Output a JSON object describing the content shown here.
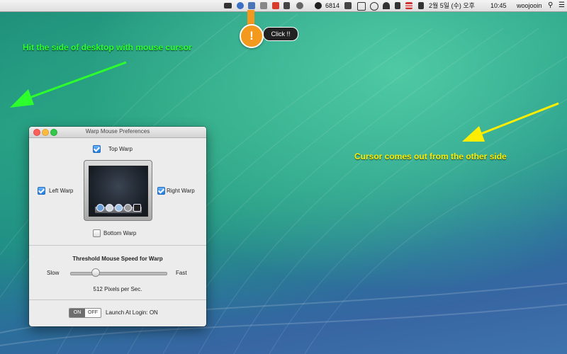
{
  "menubar": {
    "count": "6814",
    "date": "2월 5일 (수) 오후",
    "time": "10:45",
    "user": "woojooin"
  },
  "callout": {
    "exclaim": "!",
    "bubble": "Click !!"
  },
  "annotations": {
    "green": "Hit the side of desktop with mouse cursor",
    "yellow": "Cursor comes out from the other side"
  },
  "window": {
    "title": "Warp Mouse Preferences",
    "top_warp": "Top Warp",
    "left_warp": "Left Warp",
    "right_warp": "Right Warp",
    "bottom_warp": "Bottom Warp",
    "threshold_title": "Threshold Mouse Speed for Warp",
    "slow": "Slow",
    "fast": "Fast",
    "speed_value": "512 Pixels per Sec.",
    "toggle_on": "ON",
    "toggle_off": "OFF",
    "launch_label": "Launch At Login: ON"
  },
  "state": {
    "top_warp_checked": true,
    "left_warp_checked": true,
    "right_warp_checked": true,
    "bottom_warp_checked": false,
    "slider_fraction": 0.26
  },
  "colors": {
    "annotation_green": "#2cff2c",
    "annotation_yellow": "#ffee00",
    "callout_orange": "#f39a1e"
  }
}
